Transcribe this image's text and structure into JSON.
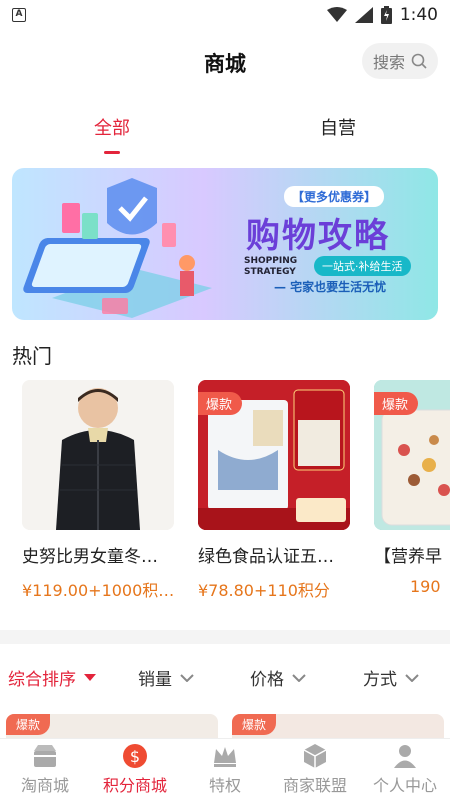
{
  "status_bar": {
    "left_badge": "A",
    "time": "1:40"
  },
  "header": {
    "title": "商城",
    "search_label": "搜索"
  },
  "tabs": [
    {
      "label": "全部",
      "active": true
    },
    {
      "label": "自营",
      "active": false
    }
  ],
  "banner": {
    "tag": "【更多优惠券】",
    "title": "购物攻略",
    "en_line1": "SHOPPING",
    "en_line2": "STRATEGY",
    "pill": "一站式·补给生活",
    "slogan": "— 宅家也要生活无忧"
  },
  "hot": {
    "title": "热门",
    "products": [
      {
        "name": "史努比男女童冬…",
        "price": "¥119.00+1000积…",
        "tag": ""
      },
      {
        "name": "绿色食品认证五…",
        "price": "¥78.80+110积分",
        "tag": "爆款"
      },
      {
        "name": "【营养早",
        "price": "190",
        "tag": "爆款"
      }
    ]
  },
  "sort": [
    {
      "label": "综合排序",
      "active": true
    },
    {
      "label": "销量",
      "active": false
    },
    {
      "label": "价格",
      "active": false
    },
    {
      "label": "方式",
      "active": false
    }
  ],
  "peek_tags": [
    "爆款",
    "爆款"
  ],
  "bottom_nav": [
    {
      "label": "淘商城",
      "icon": "store-icon",
      "active": false
    },
    {
      "label": "积分商城",
      "icon": "coin-dollar-icon",
      "active": true
    },
    {
      "label": "特权",
      "icon": "crown-icon",
      "active": false
    },
    {
      "label": "商家联盟",
      "icon": "cube-icon",
      "active": false
    },
    {
      "label": "个人中心",
      "icon": "person-icon",
      "active": false
    }
  ],
  "colors": {
    "accent": "#e3243b",
    "price": "#e6761c",
    "hot_tag": "#f05a4a"
  }
}
